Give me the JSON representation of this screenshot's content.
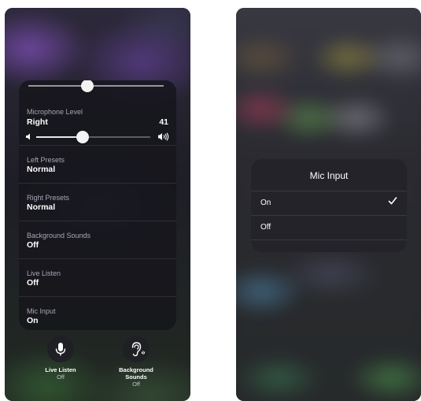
{
  "left_screen": {
    "panel": {
      "mic_level": {
        "label": "Microphone Level",
        "side": "Right",
        "value": "41",
        "level_fraction": 0.41
      },
      "rows": [
        {
          "label": "Left Presets",
          "value": "Normal"
        },
        {
          "label": "Right Presets",
          "value": "Normal"
        },
        {
          "label": "Background Sounds",
          "value": "Off"
        },
        {
          "label": "Live Listen",
          "value": "Off"
        },
        {
          "label": "Mic Input",
          "value": "On"
        }
      ]
    },
    "buttons": [
      {
        "label": "Live Listen",
        "state": "Off",
        "icon": "microphone-icon"
      },
      {
        "label_line1": "Background",
        "label_line2": "Sounds",
        "state": "Off",
        "icon": "ear-icon"
      }
    ]
  },
  "right_screen": {
    "popup": {
      "title": "Mic Input",
      "options": [
        {
          "label": "On",
          "selected": true
        },
        {
          "label": "Off",
          "selected": false
        }
      ]
    }
  }
}
